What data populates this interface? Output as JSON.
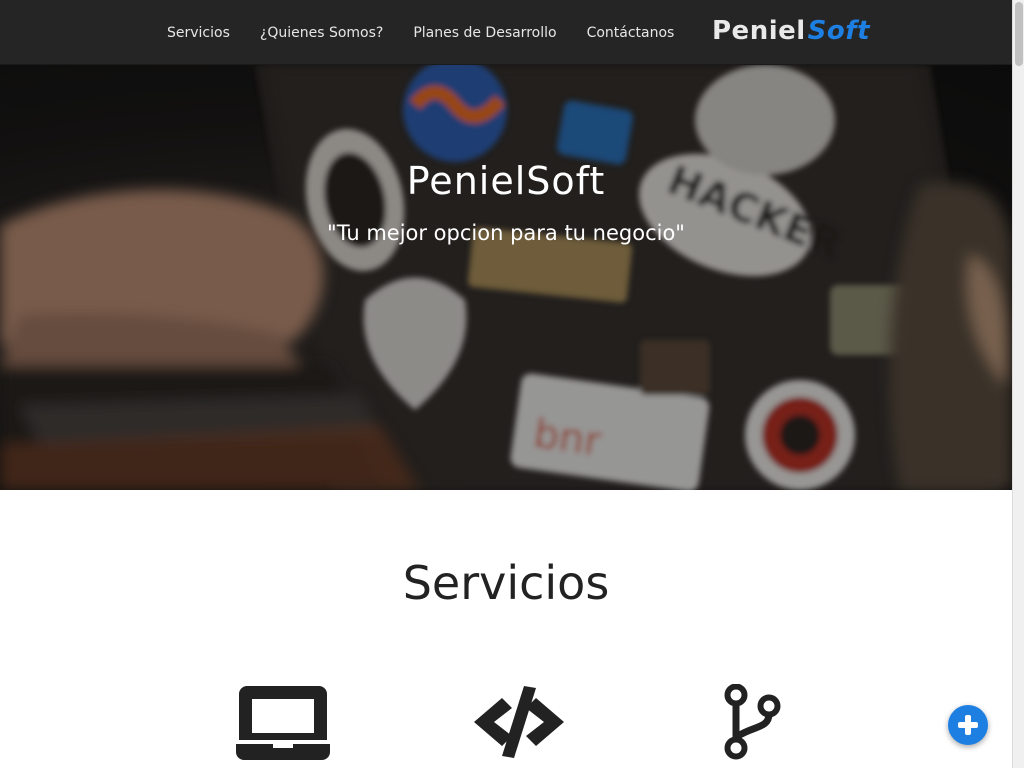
{
  "nav": {
    "links": [
      {
        "label": "Servicios"
      },
      {
        "label": "¿Quienes Somos?"
      },
      {
        "label": "Planes de Desarrollo"
      },
      {
        "label": "Contáctanos"
      }
    ],
    "brand_part1": "Peniel",
    "brand_part2": "Soft",
    "brand_accent_color": "#1e7fe3"
  },
  "hero": {
    "title": "PenielSoft",
    "subtitle": "\"Tu mejor opcion para tu negocio\""
  },
  "services": {
    "title": "Servicios",
    "icons": [
      "laptop-icon",
      "code-icon",
      "code-branch-icon"
    ]
  },
  "fab": {
    "icon": "plus-icon",
    "color": "#1e7fe3"
  }
}
